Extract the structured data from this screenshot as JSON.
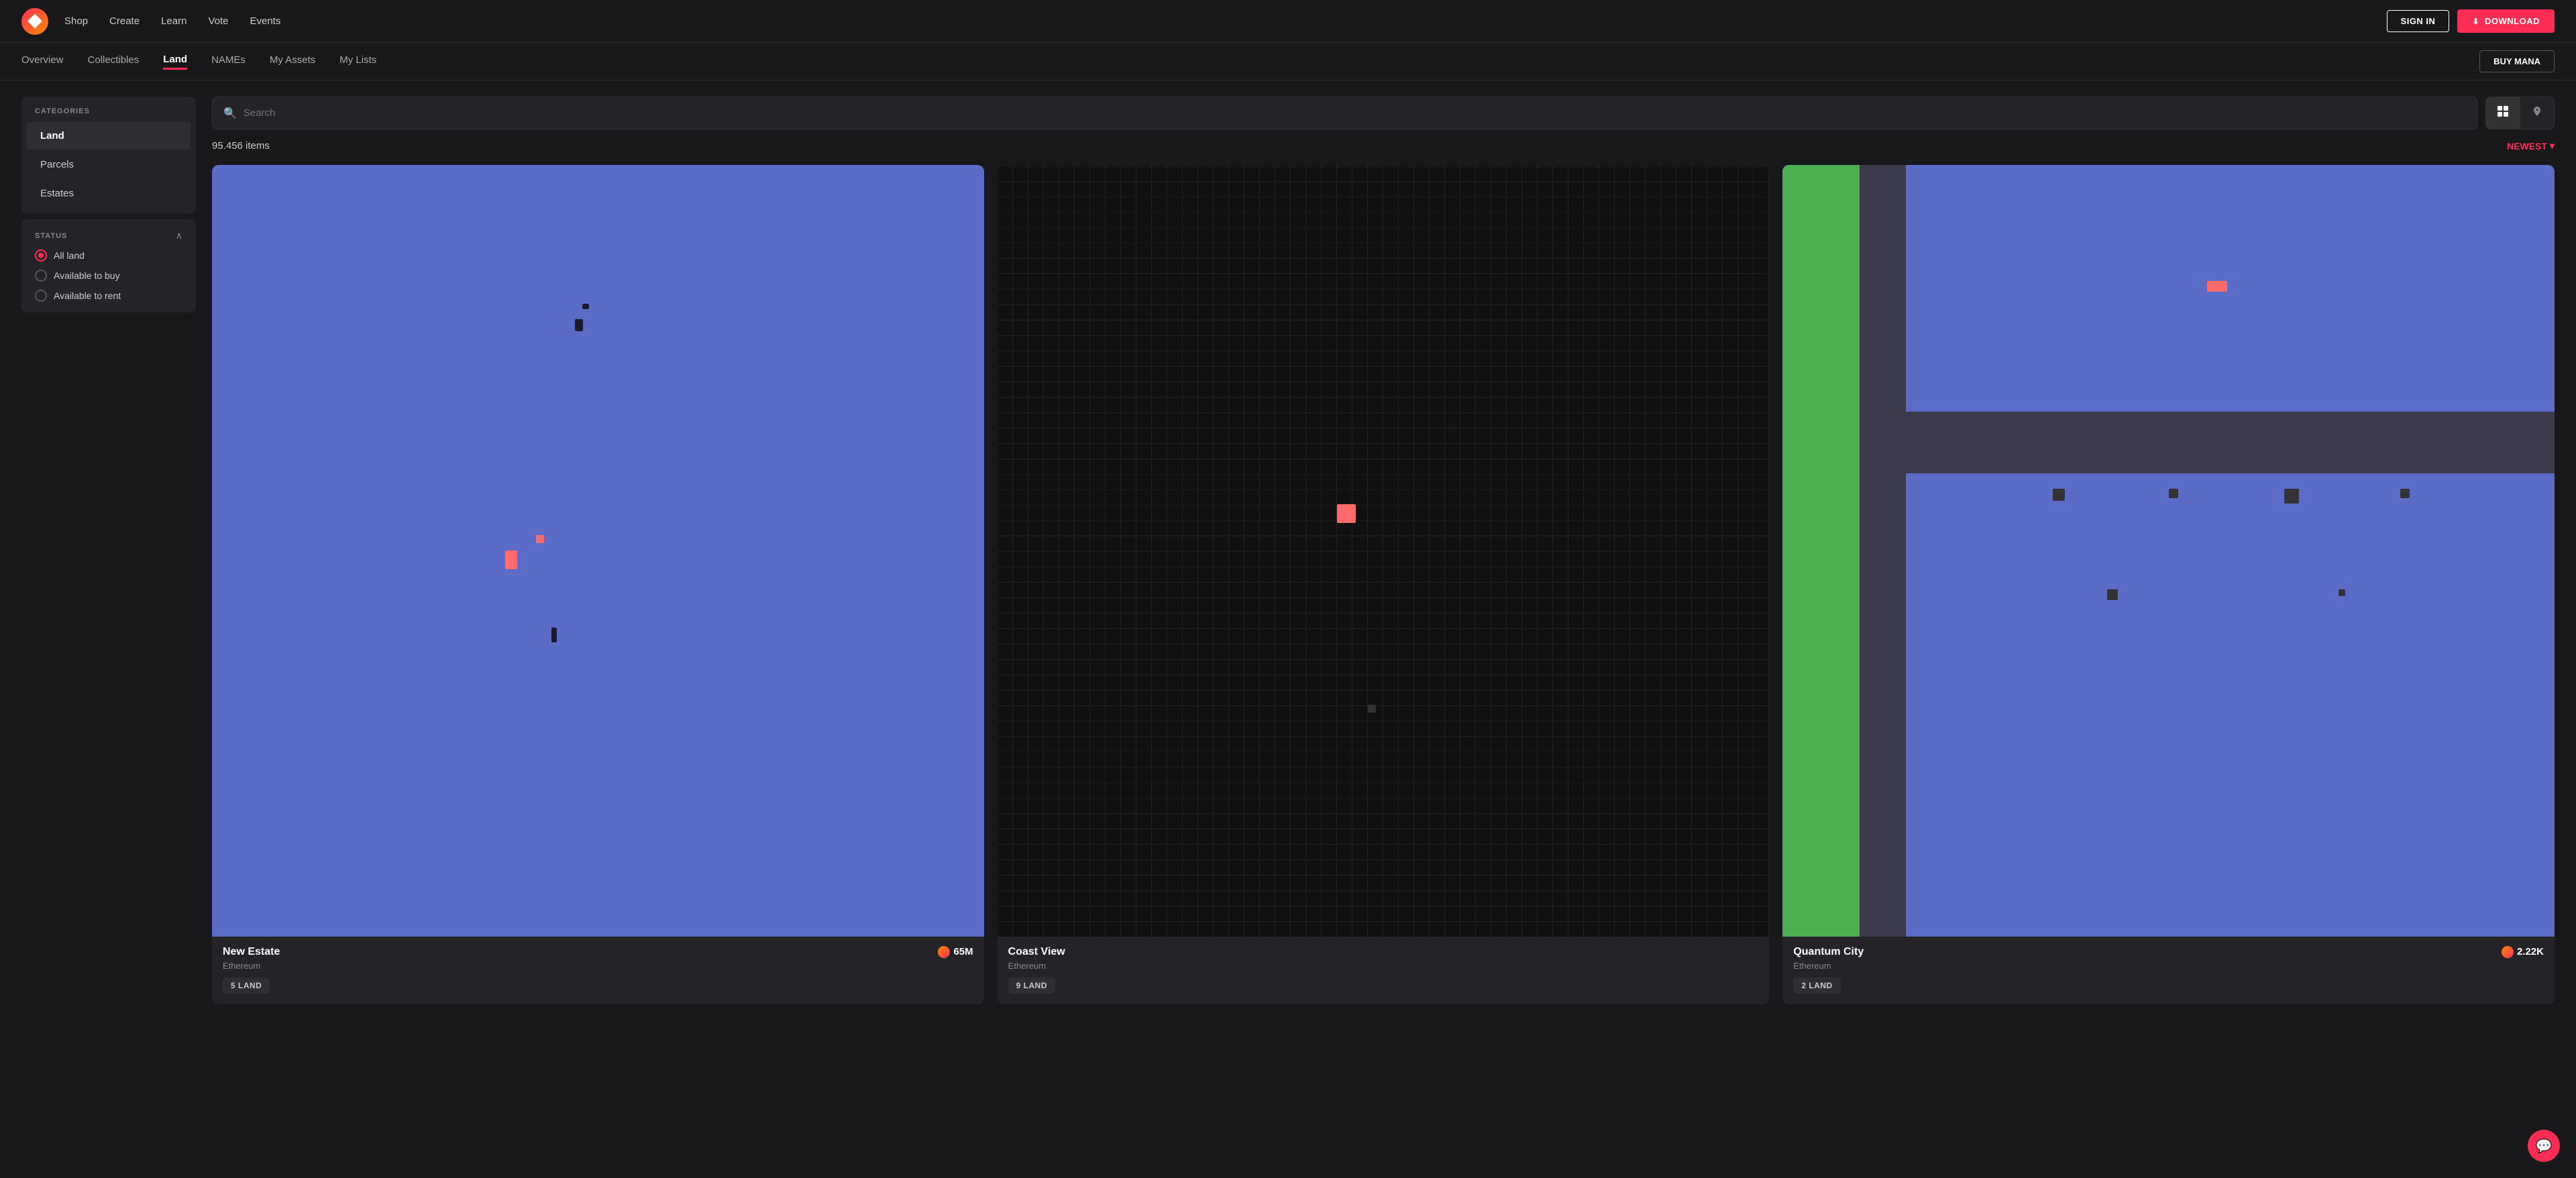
{
  "app": {
    "logo_alt": "Decentraland logo"
  },
  "topnav": {
    "links": [
      {
        "id": "shop",
        "label": "Shop"
      },
      {
        "id": "create",
        "label": "Create"
      },
      {
        "id": "learn",
        "label": "Learn"
      },
      {
        "id": "vote",
        "label": "Vote"
      },
      {
        "id": "events",
        "label": "Events"
      }
    ],
    "signin_label": "SIGN IN",
    "download_label": "DOWNLOAD"
  },
  "secnav": {
    "tabs": [
      {
        "id": "overview",
        "label": "Overview"
      },
      {
        "id": "collectibles",
        "label": "Collectibles"
      },
      {
        "id": "land",
        "label": "Land",
        "active": true
      },
      {
        "id": "names",
        "label": "NAMEs"
      },
      {
        "id": "my-assets",
        "label": "My Assets"
      },
      {
        "id": "my-lists",
        "label": "My Lists"
      }
    ],
    "buy_mana_label": "BUY MANA"
  },
  "sidebar": {
    "categories_label": "CATEGORIES",
    "items": [
      {
        "id": "land",
        "label": "Land",
        "active": true
      },
      {
        "id": "parcels",
        "label": "Parcels"
      },
      {
        "id": "estates",
        "label": "Estates"
      }
    ],
    "status_label": "STATUS",
    "status_options": [
      {
        "id": "all",
        "label": "All land",
        "checked": true
      },
      {
        "id": "buy",
        "label": "Available to buy",
        "checked": false
      },
      {
        "id": "rent",
        "label": "Available to rent",
        "checked": false
      }
    ]
  },
  "search": {
    "placeholder": "Search"
  },
  "results": {
    "count": "95.456 items",
    "sort_label": "NEWEST"
  },
  "cards": [
    {
      "id": "new-estate",
      "title": "New Estate",
      "blockchain": "Ethereum",
      "price": "65M",
      "badge": "5 LAND",
      "thumb_type": "map1"
    },
    {
      "id": "coast-view",
      "title": "Coast View",
      "blockchain": "Ethereum",
      "price": null,
      "badge": "9 LAND",
      "thumb_type": "map2"
    },
    {
      "id": "quantum-city",
      "title": "Quantum City",
      "blockchain": "Ethereum",
      "price": "2.22K",
      "badge": "2 LAND",
      "thumb_type": "map3"
    }
  ],
  "icons": {
    "search": "🔍",
    "grid": "⊞",
    "map_pin": "📍",
    "chevron_up": "∧",
    "chevron_down": "∨",
    "chat": "💬",
    "sort_arrow": "▾"
  }
}
